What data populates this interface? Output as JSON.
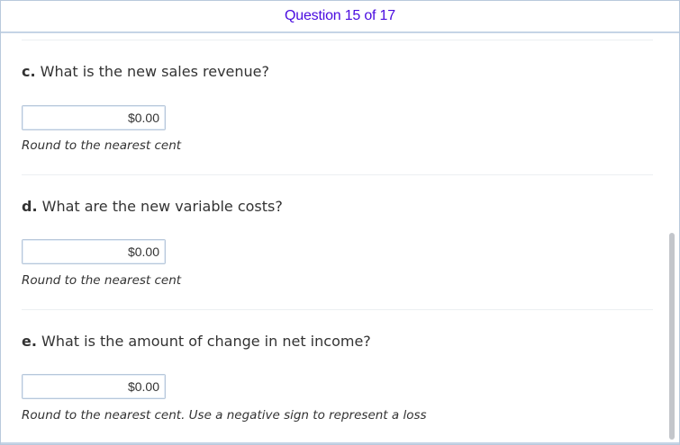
{
  "header": {
    "title": "Question 15 of 17"
  },
  "questions": [
    {
      "letter": "c.",
      "text": "What is the new sales revenue?",
      "input_value": "$0.00",
      "hint": "Round to the nearest cent"
    },
    {
      "letter": "d.",
      "text": "What are the new variable costs?",
      "input_value": "$0.00",
      "hint": "Round to the nearest cent"
    },
    {
      "letter": "e.",
      "text": "What is the amount of change in net income?",
      "input_value": "$0.00",
      "hint": "Round to the nearest cent. Use a negative sign to represent a loss"
    }
  ]
}
